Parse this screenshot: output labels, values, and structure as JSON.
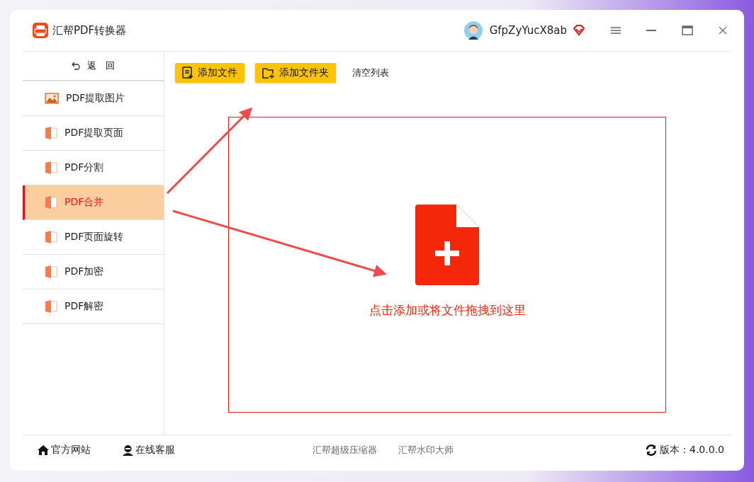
{
  "window": {
    "title": "汇帮PDF转换器",
    "username": "GfpZyYucX8ab"
  },
  "sidebar": {
    "back": "返　回",
    "items": [
      {
        "label": "PDF提取图片",
        "kind": "image",
        "selected": false
      },
      {
        "label": "PDF提取页面",
        "kind": "pdf",
        "selected": false
      },
      {
        "label": "PDF分割",
        "kind": "pdf",
        "selected": false
      },
      {
        "label": "PDF合并",
        "kind": "pdf",
        "selected": true
      },
      {
        "label": "PDF页面旋转",
        "kind": "pdf",
        "selected": false
      },
      {
        "label": "PDF加密",
        "kind": "pdf",
        "selected": false
      },
      {
        "label": "PDF解密",
        "kind": "pdf",
        "selected": false
      }
    ]
  },
  "toolbar": {
    "buttons": [
      {
        "label": "添加文件",
        "kind": "file"
      },
      {
        "label": "添加文件夹",
        "kind": "folder"
      }
    ],
    "clear": "清空列表"
  },
  "dropzone": {
    "hint": "点击添加或将文件拖拽到这里"
  },
  "status_bar": {
    "links": [
      {
        "label": "官方网站",
        "kind": "home"
      },
      {
        "label": "在线客服",
        "kind": "support"
      }
    ],
    "products": [
      "汇帮超级压缩器",
      "汇帮水印大师"
    ],
    "version": "版本：4.0.0.0"
  }
}
